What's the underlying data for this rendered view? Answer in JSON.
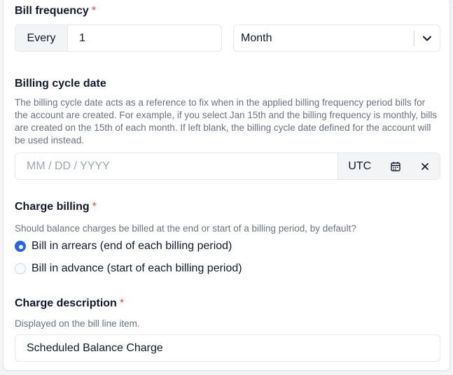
{
  "bill_frequency": {
    "label": "Bill frequency",
    "required_mark": "*",
    "prefix": "Every",
    "value": "1",
    "period": "Month"
  },
  "billing_cycle": {
    "label": "Billing cycle date",
    "help": "The billing cycle date acts as a reference to fix when in the applied billing frequency period bills for the account are created. For example, if you select Jan 15th and the billing frequency is monthly, bills are created on the 15th of each month. If left blank, the billing cycle date defined for the account will be used instead.",
    "placeholder": "MM / DD / YYYY",
    "timezone": "UTC",
    "icons": {
      "calendar": "calendar-icon",
      "clear": "close-icon"
    }
  },
  "charge_billing": {
    "label": "Charge billing",
    "required_mark": "*",
    "help": "Should balance charges be billed at the end or start of a billing period, by default?",
    "options": [
      {
        "label": "Bill in arrears (end of each billing period)",
        "checked": true
      },
      {
        "label": "Bill in advance (start of each billing period)",
        "checked": false
      }
    ]
  },
  "charge_description": {
    "label": "Charge description",
    "required_mark": "*",
    "help": "Displayed on the bill line item.",
    "value": "Scheduled Balance Charge"
  },
  "colors": {
    "accent": "#2563eb",
    "required": "#ef4444",
    "muted": "#6b7280",
    "border": "#e5e7eb"
  }
}
